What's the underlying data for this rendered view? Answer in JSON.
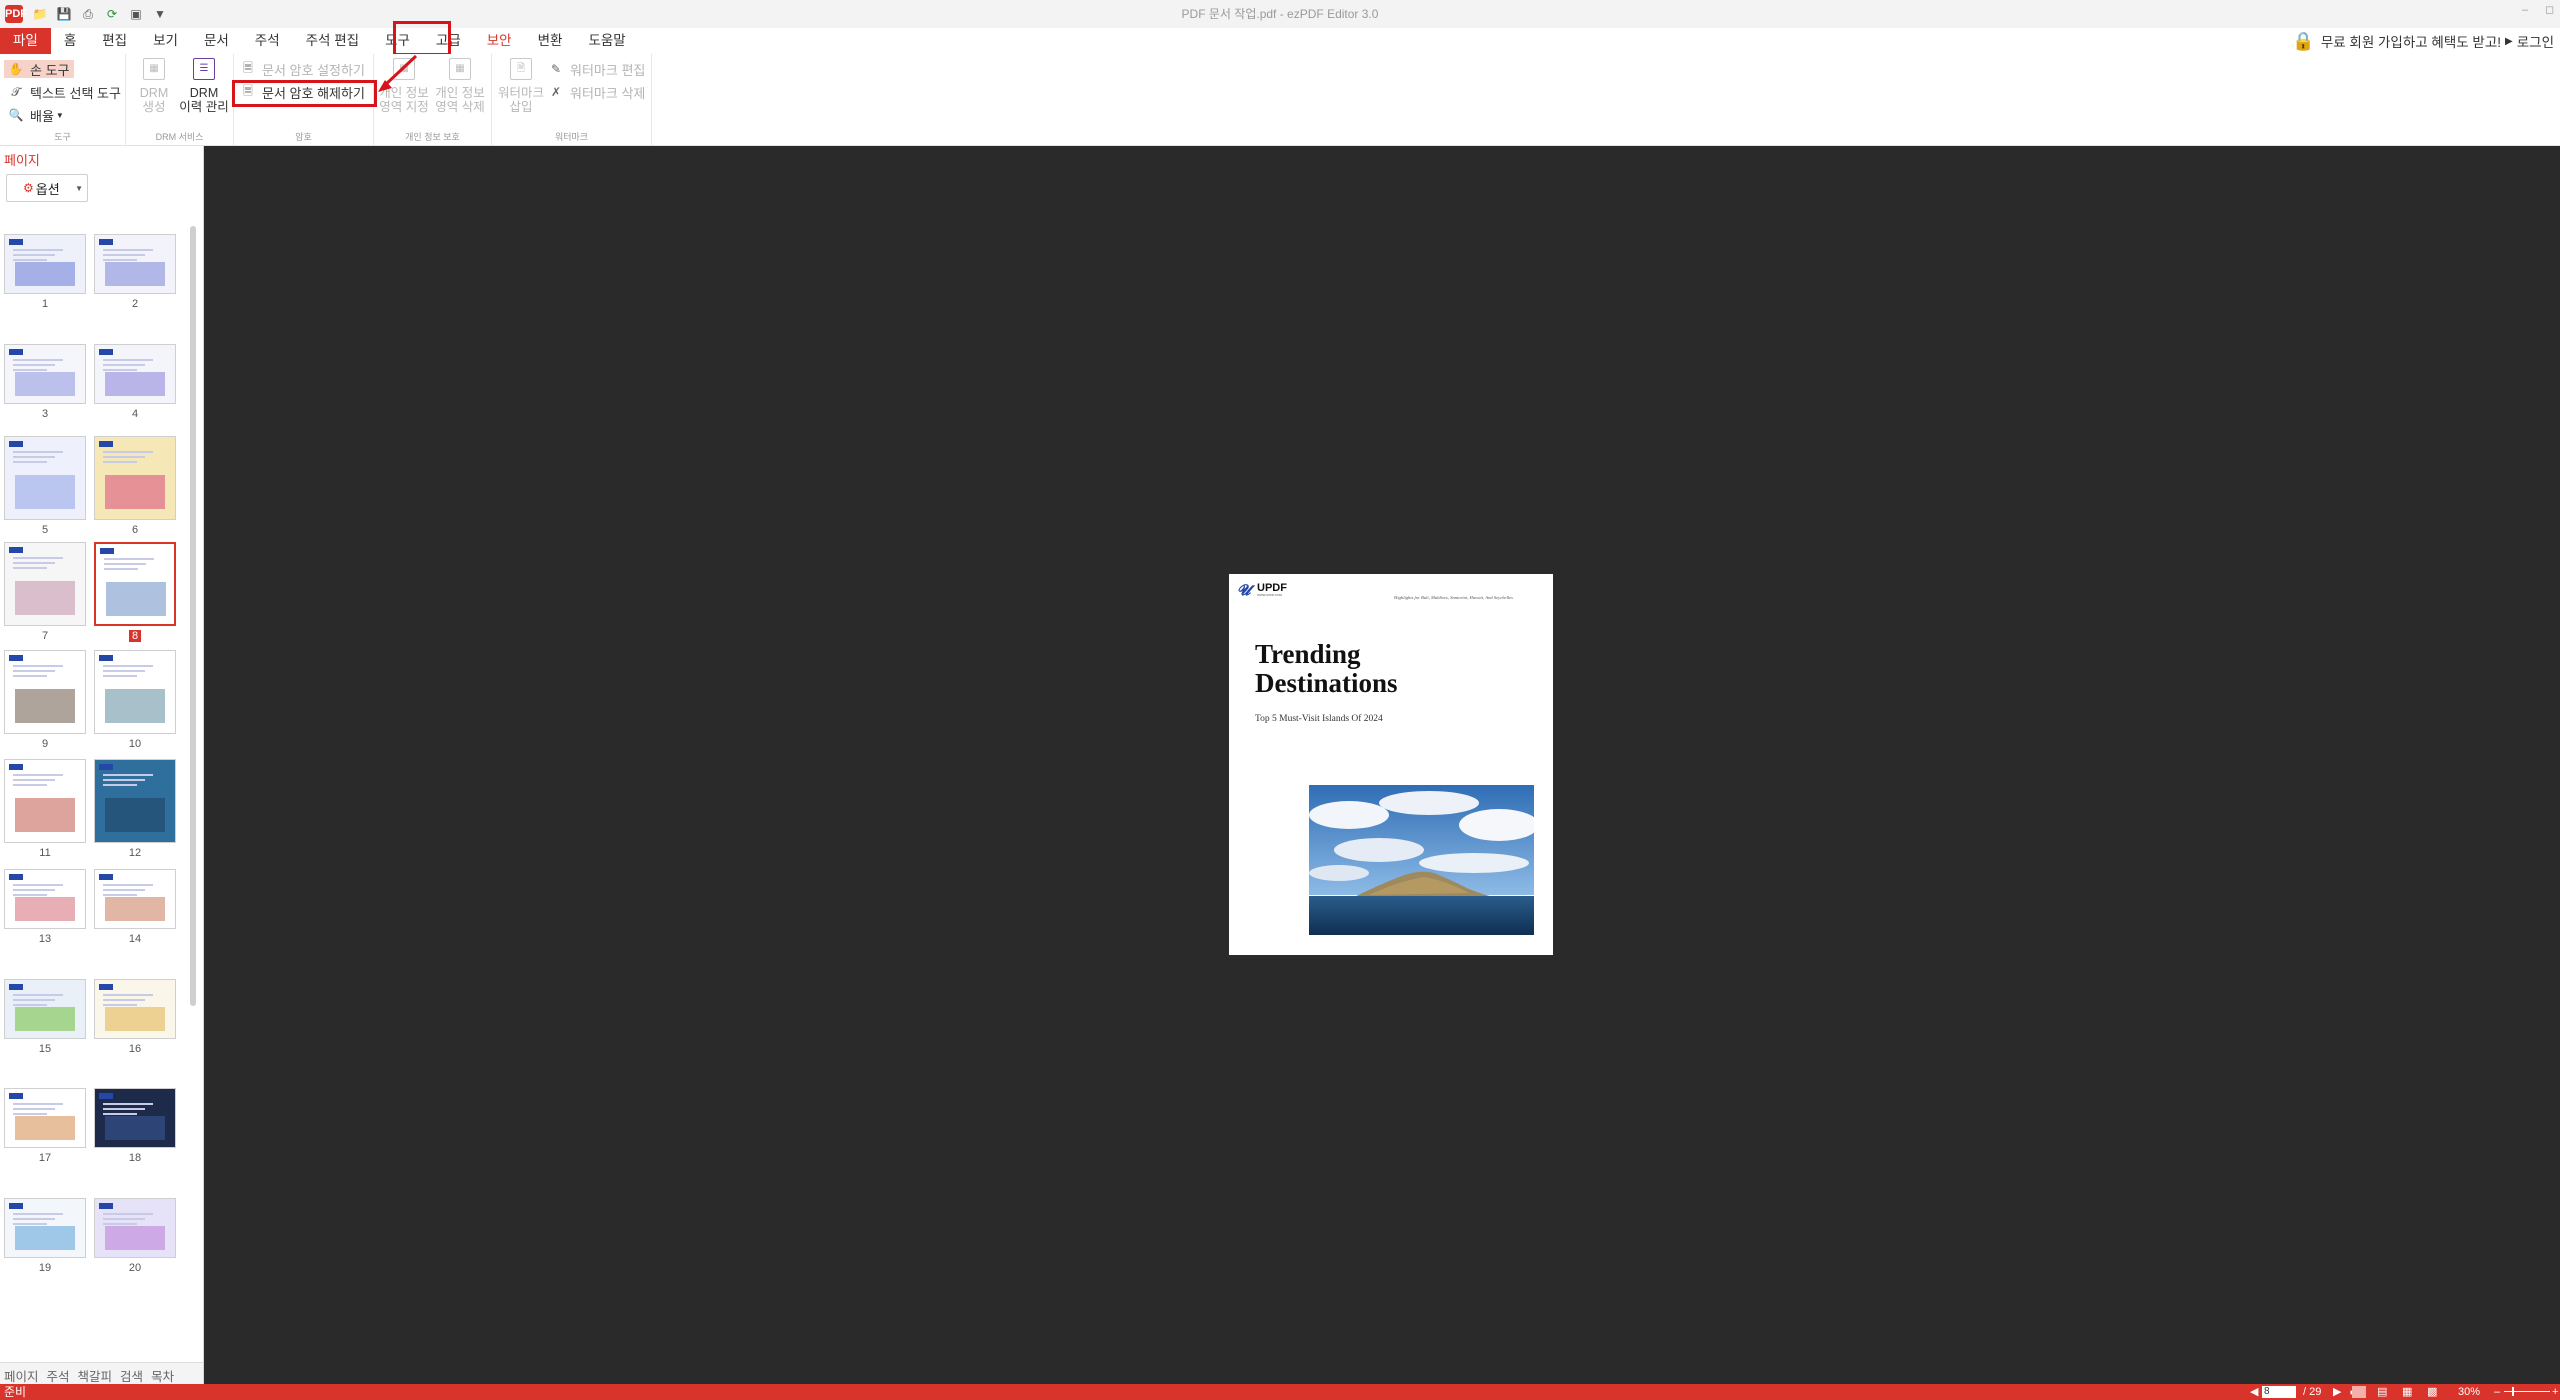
{
  "window": {
    "title": "PDF 문서 작업.pdf - ezPDF Editor 3.0",
    "app_logo": "PDF"
  },
  "quick_access": [
    "folder-icon",
    "save-icon",
    "print-icon",
    "refresh-icon",
    "window-icon",
    "dropdown-icon"
  ],
  "menu": {
    "tabs": [
      "파일",
      "홈",
      "편집",
      "보기",
      "문서",
      "주석",
      "주석 편집",
      "도구",
      "고급",
      "보안",
      "변환",
      "도움말"
    ],
    "active": "보안"
  },
  "promo": {
    "text": "무료 회원 가입하고 혜택도 받고!",
    "login": "로그인"
  },
  "ribbon": {
    "tools_group": {
      "label": "도구",
      "hand": "손 도구",
      "text_select": "텍스트 선택 도구",
      "zoom": "배율"
    },
    "drm_group": {
      "label": "DRM 서비스",
      "create_line1": "DRM",
      "create_line2": "생성",
      "history_line1": "DRM",
      "history_line2": "이력 관리"
    },
    "encrypt_group": {
      "label": "암호",
      "set_password": "문서 암호 설정하기",
      "remove_password": "문서 암호 해제하기"
    },
    "privacy_group": {
      "label": "개인 정보 보호",
      "area_line1": "개인 정보",
      "area_line2": "영역 지정",
      "delete_line1": "개인 정보",
      "delete_line2": "영역 삭제"
    },
    "watermark_group": {
      "label": "워터마크",
      "insert_line1": "워터마크",
      "insert_line2": "삽입",
      "edit": "워터마크 편집",
      "delete": "워터마크 삭제"
    }
  },
  "side_panel": {
    "title": "페이지",
    "options_button": "옵션",
    "pages": [
      "1",
      "2",
      "3",
      "4",
      "5",
      "6",
      "7",
      "8",
      "9",
      "10",
      "11",
      "12",
      "13",
      "14",
      "15",
      "16",
      "17",
      "18",
      "19",
      "20"
    ],
    "current_page": "8",
    "bottom_tabs": [
      "페이지",
      "주석",
      "책갈피",
      "검색",
      "목차"
    ]
  },
  "document": {
    "logo_text": "UPDF",
    "logo_sub": "WWW.UPDF.COM",
    "highlights": "Highlights for Bali, Maldives, Santorini, Hawaii, And Seychelles",
    "title_line1": "Trending",
    "title_line2": "Destinations",
    "subtitle": "Top 5 Must-Visit Islands Of 2024"
  },
  "status": {
    "text": "준비",
    "page_input": "8",
    "total_pages": "/ 29",
    "zoom": "30%"
  },
  "colors": {
    "accent": "#d9342b",
    "highlight_box": "#d8141b",
    "viewer_bg": "#2a2a2a"
  }
}
